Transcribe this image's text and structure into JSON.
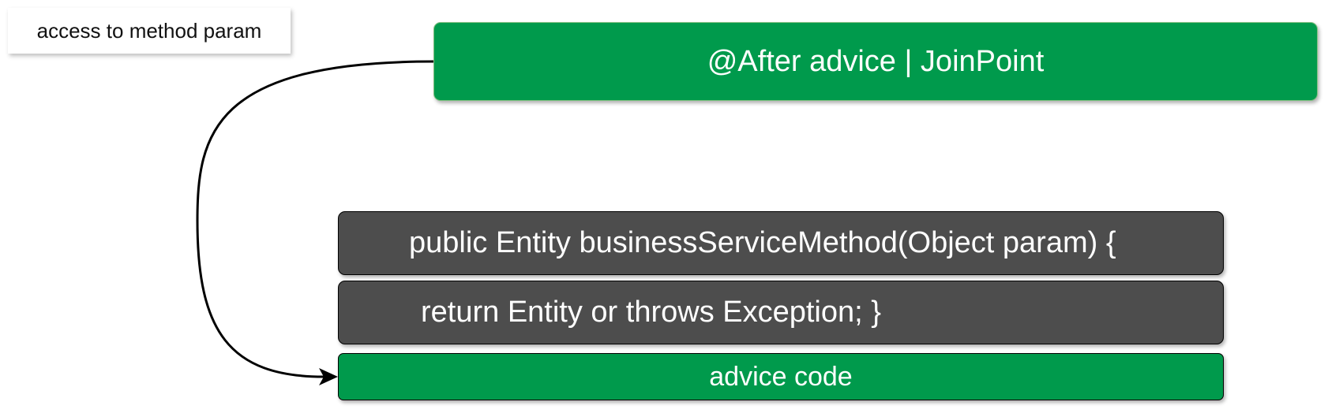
{
  "note": {
    "text": "access to method param"
  },
  "advice_header": {
    "text": "@After advice | JoinPoint"
  },
  "method_code": {
    "line1": "public Entity businessServiceMethod(Object param) {",
    "line2": "return Entity or throws Exception; }"
  },
  "advice_code": {
    "text": "advice code"
  },
  "colors": {
    "green": "#009a4c",
    "dark_gray": "#4d4d4d",
    "connector": "#000000"
  }
}
